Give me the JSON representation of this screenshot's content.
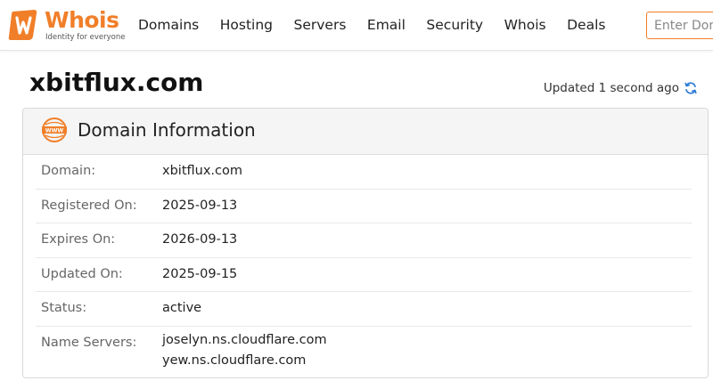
{
  "header": {
    "logo": {
      "word": "Whois",
      "tagline": "Identity for everyone"
    },
    "nav": [
      "Domains",
      "Hosting",
      "Servers",
      "Email",
      "Security",
      "Whois",
      "Deals"
    ],
    "search": {
      "placeholder": "Enter Domain or IP",
      "value": ""
    }
  },
  "page": {
    "domain_title": "xbitflux.com",
    "updated_text": "Updated 1 second ago"
  },
  "card": {
    "title": "Domain Information",
    "rows": [
      {
        "label": "Domain:",
        "value": "xbitflux.com"
      },
      {
        "label": "Registered On:",
        "value": "2025-09-13"
      },
      {
        "label": "Expires On:",
        "value": "2026-09-13"
      },
      {
        "label": "Updated On:",
        "value": "2025-09-15"
      },
      {
        "label": "Status:",
        "value": "active"
      },
      {
        "label": "Name Servers:",
        "values": [
          "joselyn.ns.cloudflare.com",
          "yew.ns.cloudflare.com"
        ]
      }
    ]
  },
  "colors": {
    "brand": "#f17f29",
    "refresh": "#2a7bd4",
    "card_header": "#f5f5f5"
  },
  "icons": {
    "logo": "whois-logo-icon",
    "refresh": "refresh-icon",
    "www": "www-icon"
  }
}
